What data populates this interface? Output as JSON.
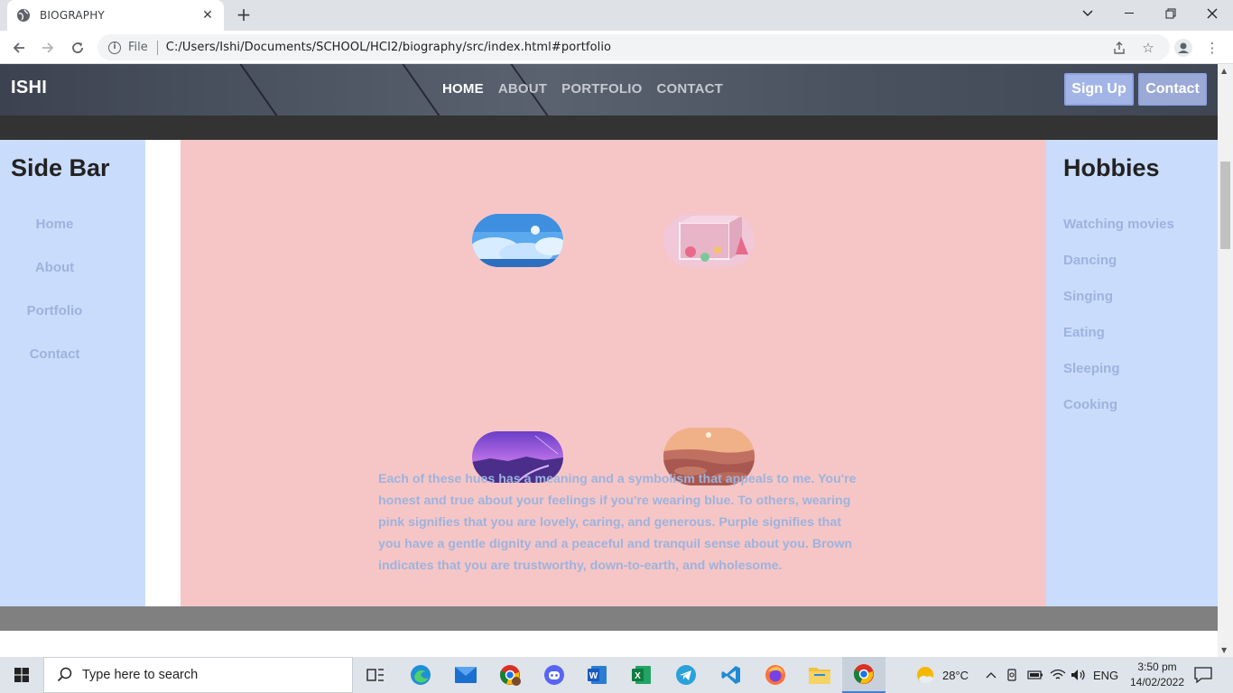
{
  "browser": {
    "tab_title": "BIOGRAPHY",
    "file_label": "File",
    "url": "C:/Users/Ishi/Documents/SCHOOL/HCI2/biography/src/index.html#portfolio"
  },
  "header": {
    "brand": "ISHI",
    "nav": [
      "HOME",
      "ABOUT",
      "PORTFOLIO",
      "CONTACT"
    ],
    "active_nav": "HOME",
    "signup_label": "Sign Up",
    "contact_label": "Contact"
  },
  "sidebar": {
    "title": "Side Bar",
    "items": [
      "Home",
      "About",
      "Portfolio",
      "Contact"
    ]
  },
  "portfolio": {
    "images": [
      {
        "name": "blue-sky-image",
        "theme": "blue"
      },
      {
        "name": "pink-cube-image",
        "theme": "pink"
      },
      {
        "name": "purple-night-image",
        "theme": "purple"
      },
      {
        "name": "brown-desert-image",
        "theme": "brown"
      }
    ],
    "description": "Each of these hues has a meaning and a symbolism that appeals to me. You're honest and true about your feelings if you're wearing blue. To others, wearing pink signifies that you are lovely, caring, and generous. Purple signifies that you have a gentle dignity and a peaceful and tranquil sense about you. Brown indicates that you are trustworthy, down-to-earth, and wholesome."
  },
  "hobbies": {
    "title": "Hobbies",
    "items": [
      "Watching movies",
      "Dancing",
      "Singing",
      "Eating",
      "Sleeping",
      "Cooking"
    ]
  },
  "taskbar": {
    "search_placeholder": "Type here to search",
    "weather": "28°C",
    "language": "ENG",
    "time": "3:50 pm",
    "date": "14/02/2022"
  },
  "colors": {
    "sidebar_bg": "#cadcfc",
    "main_bg": "#f6c6c6",
    "link": "#9db3de",
    "button": "#a3b5e6"
  }
}
